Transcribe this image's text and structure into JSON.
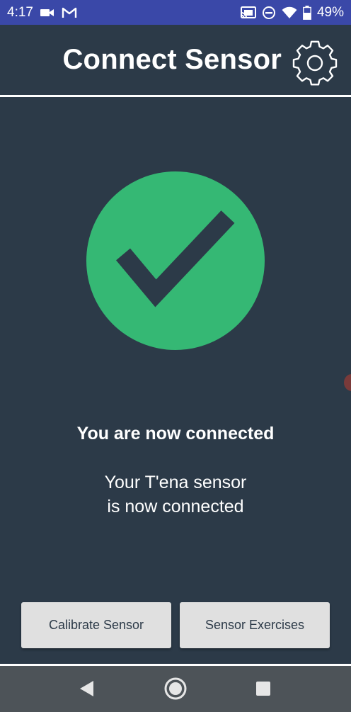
{
  "status_bar": {
    "time": "4:17",
    "battery": "49%",
    "icons": [
      "video-camera-icon",
      "gmail-icon",
      "cast-icon",
      "do-not-disturb-icon",
      "wifi-icon",
      "battery-icon"
    ]
  },
  "header": {
    "title": "Connect Sensor",
    "settings_icon": "gear-icon"
  },
  "status": {
    "icon": "check-circle-icon",
    "title": "You are now connected",
    "body_line1": "Your T'ena sensor",
    "body_line2": "is now connected"
  },
  "actions": {
    "calibrate_label": "Calibrate Sensor",
    "exercises_label": "Sensor Exercises"
  },
  "nav": {
    "icons": [
      "back-icon",
      "home-icon",
      "recents-icon"
    ]
  },
  "colors": {
    "background": "#2c3a48",
    "status_bar": "#3a48a8",
    "success": "#35b874",
    "button": "#e0e0e0",
    "nav_bar": "#4d5358"
  }
}
